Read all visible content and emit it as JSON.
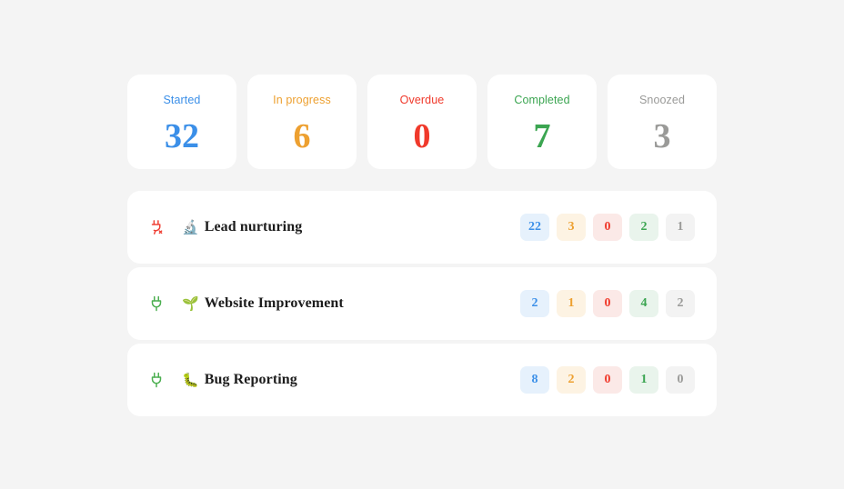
{
  "theme": {
    "page_background": "#f4f4f4",
    "card_background": "#ffffff",
    "title_color": "#1c1c1c"
  },
  "palette": {
    "started": "#3b8fe8",
    "in_progress": "#eda030",
    "overdue": "#f0392b",
    "completed": "#3ba551",
    "snoozed": "#9a9a98",
    "started_bg": "#e6f1fc",
    "in_progress_bg": "#fdf3e3",
    "overdue_bg": "#fbe9e7",
    "completed_bg": "#e9f4ec",
    "snoozed_bg": "#f3f3f3",
    "icon_connected": "#4caf50",
    "icon_disconnected": "#ef4136"
  },
  "stats": [
    {
      "label": "Started",
      "value": "32",
      "color": "#3b8fe8",
      "name": "started"
    },
    {
      "label": "In progress",
      "value": "6",
      "color": "#eda030",
      "name": "in-progress"
    },
    {
      "label": "Overdue",
      "value": "0",
      "color": "#f0392b",
      "name": "overdue"
    },
    {
      "label": "Completed",
      "value": "7",
      "color": "#3ba551",
      "name": "completed"
    },
    {
      "label": "Snoozed",
      "value": "3",
      "color": "#9a9a98",
      "name": "snoozed"
    }
  ],
  "projects": [
    {
      "title": "Lead nurturing",
      "emoji": "🔬",
      "emoji_name": "microscope-emoji",
      "status_icon": "plug-disconnected-icon",
      "status": "disconnected",
      "status_color": "#ef4136",
      "badges": [
        {
          "value": "22",
          "name": "started",
          "color": "#3b8fe8",
          "bg": "#e6f1fc"
        },
        {
          "value": "3",
          "name": "in-progress",
          "color": "#eda030",
          "bg": "#fdf3e3"
        },
        {
          "value": "0",
          "name": "overdue",
          "color": "#f0392b",
          "bg": "#fbe9e7"
        },
        {
          "value": "2",
          "name": "completed",
          "color": "#3ba551",
          "bg": "#e9f4ec"
        },
        {
          "value": "1",
          "name": "snoozed",
          "color": "#9a9a98",
          "bg": "#f3f3f3"
        }
      ]
    },
    {
      "title": "Website Improvement",
      "emoji": "🌱",
      "emoji_name": "seedling-emoji",
      "status_icon": "plug-connected-icon",
      "status": "connected",
      "status_color": "#4caf50",
      "badges": [
        {
          "value": "2",
          "name": "started",
          "color": "#3b8fe8",
          "bg": "#e6f1fc"
        },
        {
          "value": "1",
          "name": "in-progress",
          "color": "#eda030",
          "bg": "#fdf3e3"
        },
        {
          "value": "0",
          "name": "overdue",
          "color": "#f0392b",
          "bg": "#fbe9e7"
        },
        {
          "value": "4",
          "name": "completed",
          "color": "#3ba551",
          "bg": "#e9f4ec"
        },
        {
          "value": "2",
          "name": "snoozed",
          "color": "#9a9a98",
          "bg": "#f3f3f3"
        }
      ]
    },
    {
      "title": "Bug Reporting",
      "emoji": "🐛",
      "emoji_name": "bug-emoji",
      "status_icon": "plug-connected-icon",
      "status": "connected",
      "status_color": "#4caf50",
      "badges": [
        {
          "value": "8",
          "name": "started",
          "color": "#3b8fe8",
          "bg": "#e6f1fc"
        },
        {
          "value": "2",
          "name": "in-progress",
          "color": "#eda030",
          "bg": "#fdf3e3"
        },
        {
          "value": "0",
          "name": "overdue",
          "color": "#f0392b",
          "bg": "#fbe9e7"
        },
        {
          "value": "1",
          "name": "completed",
          "color": "#3ba551",
          "bg": "#e9f4ec"
        },
        {
          "value": "0",
          "name": "snoozed",
          "color": "#9a9a98",
          "bg": "#f3f3f3"
        }
      ]
    }
  ]
}
